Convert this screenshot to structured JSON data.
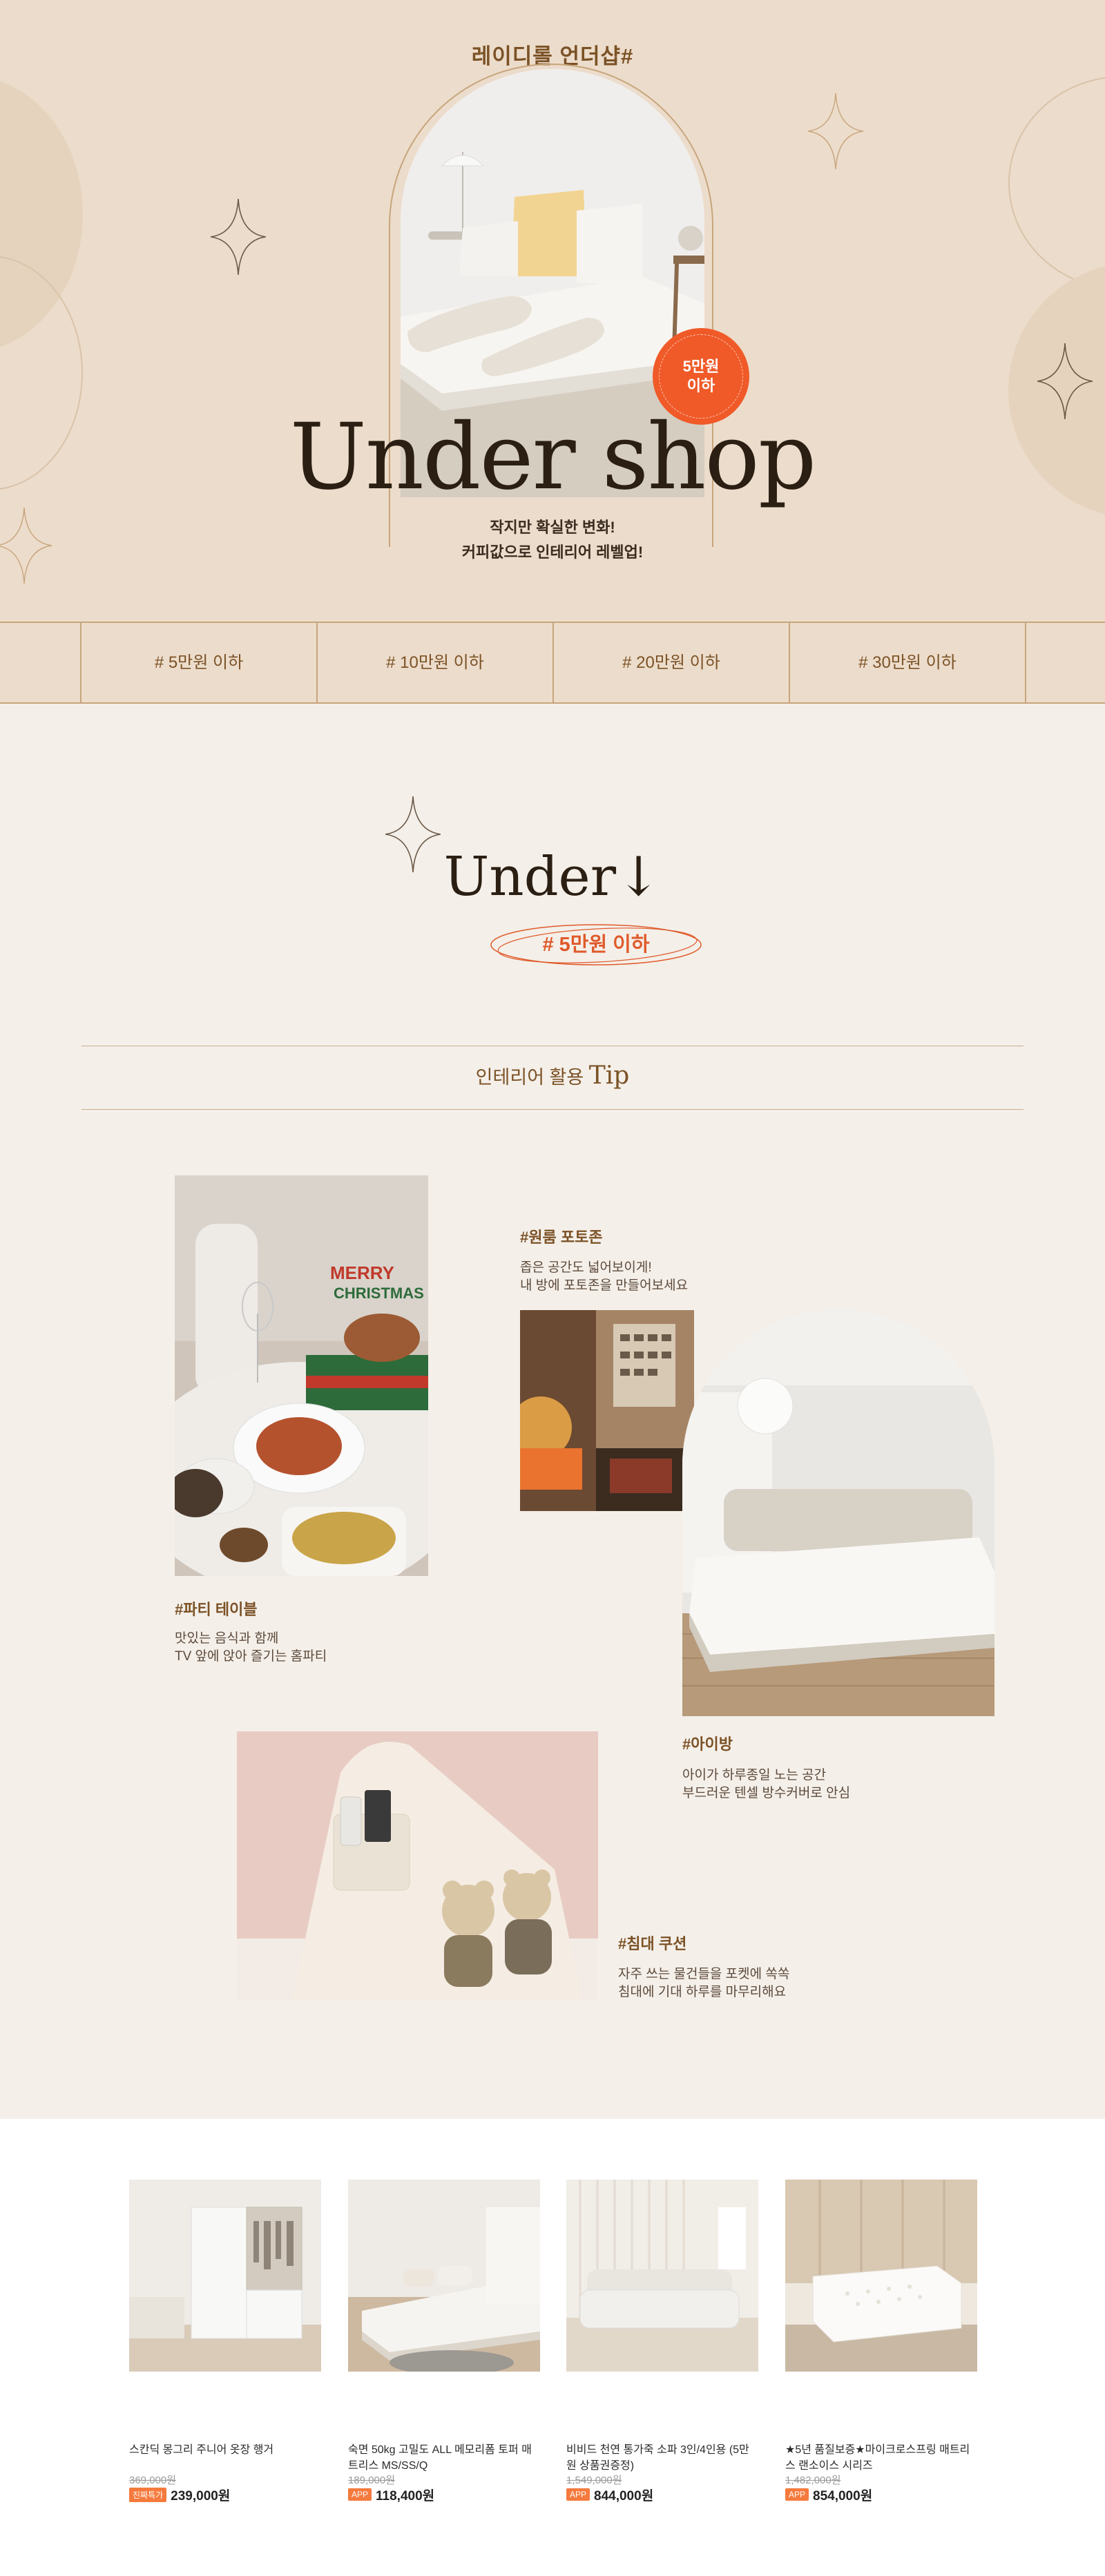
{
  "hero": {
    "brand_title": "레이디롤 언더샵#",
    "main_title": "Under shop",
    "subtitle_line1": "작지만 확실한 변화!",
    "subtitle_line2": "커피값으로 인테리어 레벨업!",
    "badge_line1": "5만원",
    "badge_line2": "이하"
  },
  "price_tabs": [
    "# 5만원 이하",
    "# 10만원 이하",
    "# 20만원 이하",
    "# 30만원 이하"
  ],
  "under_section": {
    "title": "Under",
    "pill_label": "# 5만원 이하",
    "tip_title_ko": "인테리어 활용",
    "tip_title_en": "Tip"
  },
  "tips": [
    {
      "title": "#파티 테이블",
      "desc_line1": "맛있는 음식과 함께",
      "desc_line2": "TV 앞에 앉아 즐기는 홈파티"
    },
    {
      "title": "#원룸 포토존",
      "desc_line1": "좁은 공간도 넓어보이게!",
      "desc_line2": "내 방에 포토존을 만들어보세요"
    },
    {
      "title": "#아이방",
      "desc_line1": "아이가 하루종일 노는 공간",
      "desc_line2": "부드러운 텐셀 방수커버로 안심"
    },
    {
      "title": "#침대 쿠션",
      "desc_line1": "자주 쓰는 물건들을 포켓에 쏙쏙",
      "desc_line2": "침대에 기대 하루를 마무리해요"
    }
  ],
  "products": [
    {
      "name": "스칸딕 몽그리 주니어 옷장 행거",
      "original_price": "369,000원",
      "tag": "진짜특가",
      "price": "239,000원"
    },
    {
      "name": "숙면 50kg 고밀도 ALL 메모리폼 토퍼 매트리스 MS/SS/Q",
      "original_price": "189,000원",
      "tag": "APP",
      "price": "118,400원"
    },
    {
      "name": "비비드 천연 통가죽 소파 3인/4인용 (5만원 상품권증정)",
      "original_price": "1,549,000원",
      "tag": "APP",
      "price": "844,000원"
    },
    {
      "name": "★5년 품질보증★마이크로스프링 매트리스 랜소이스 시리즈",
      "original_price": "1,482,000원",
      "tag": "APP",
      "price": "854,000원"
    }
  ],
  "colors": {
    "hero_bg": "#ecdccb",
    "page_bg": "#f4efe9",
    "accent_brown": "#7b5226",
    "accent_orange": "#f05a28"
  },
  "icons": [
    "sparkle-icon",
    "arrow-down-icon"
  ]
}
